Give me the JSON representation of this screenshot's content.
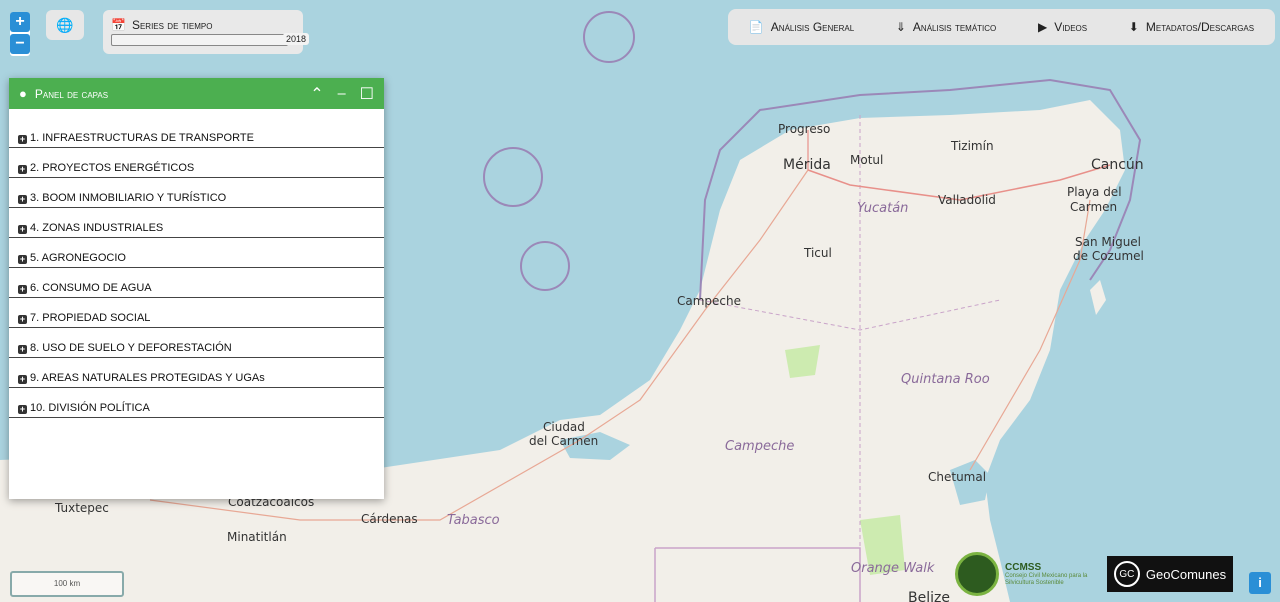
{
  "zoom": {
    "in_label": "+",
    "out_label": "−"
  },
  "globe": {
    "icon": "globe-icon"
  },
  "series": {
    "title": "Series de tiempo",
    "icon": "calendar-icon",
    "year": "2018"
  },
  "topmenu": {
    "items": [
      {
        "label": "Análisis General",
        "icon": "document-icon"
      },
      {
        "label": "Análisis temático",
        "icon": "chevrons-down-icon"
      },
      {
        "label": "Videos",
        "icon": "play-icon"
      },
      {
        "label": "Metadatos/Descargas",
        "icon": "download-icon"
      }
    ]
  },
  "panel": {
    "title": "Panel de capas",
    "items": [
      "1. INFRAESTRUCTURAS DE TRANSPORTE",
      "2. PROYECTOS ENERGÉTICOS",
      "3. BOOM INMOBILIARIO Y TURÍSTICO",
      "4. ZONAS INDUSTRIALES",
      "5. AGRONEGOCIO",
      "6. CONSUMO DE AGUA",
      "7. PROPIEDAD SOCIAL",
      "8. USO DE SUELO Y DEFORESTACIÓN",
      "9. AREAS NATURALES PROTEGIDAS Y UGAs",
      "10. DIVISIÓN POLÍTICA"
    ]
  },
  "map": {
    "labels": {
      "progreso": "Progreso",
      "merida": "Mérida",
      "motul": "Motul",
      "tizimin": "Tizimín",
      "cancun": "Cancún",
      "playa1": "Playa del",
      "playa2": "Carmen",
      "yucatan": "Yucatán",
      "valladolid": "Valladolid",
      "sanmiguel1": "San Miguel",
      "sanmiguel2": "de Cozumel",
      "ticul": "Ticul",
      "campeche_city": "Campeche",
      "quintanaroo": "Quintana Roo",
      "ciudad1": "Ciudad",
      "ciudad2": "del Carmen",
      "campeche_state": "Campeche",
      "chetumal": "Chetumal",
      "tuxtepec": "Tuxtepec",
      "coatza": "Coatzacoalcos",
      "cardenas": "Cárdenas",
      "tabasco": "Tabasco",
      "minatitlan": "Minatitlán",
      "orangewalk": "Orange Walk",
      "belize": "Belize"
    }
  },
  "scale": {
    "label": "100 km"
  },
  "logos": {
    "ccmss": "CCMSS",
    "ccmss_sub": "Consejo Civil Mexicano para la Silvicultura Sostenible",
    "geocomunes": "GeoComunes",
    "gc_badge": "GC"
  },
  "info": {
    "label": "i"
  }
}
